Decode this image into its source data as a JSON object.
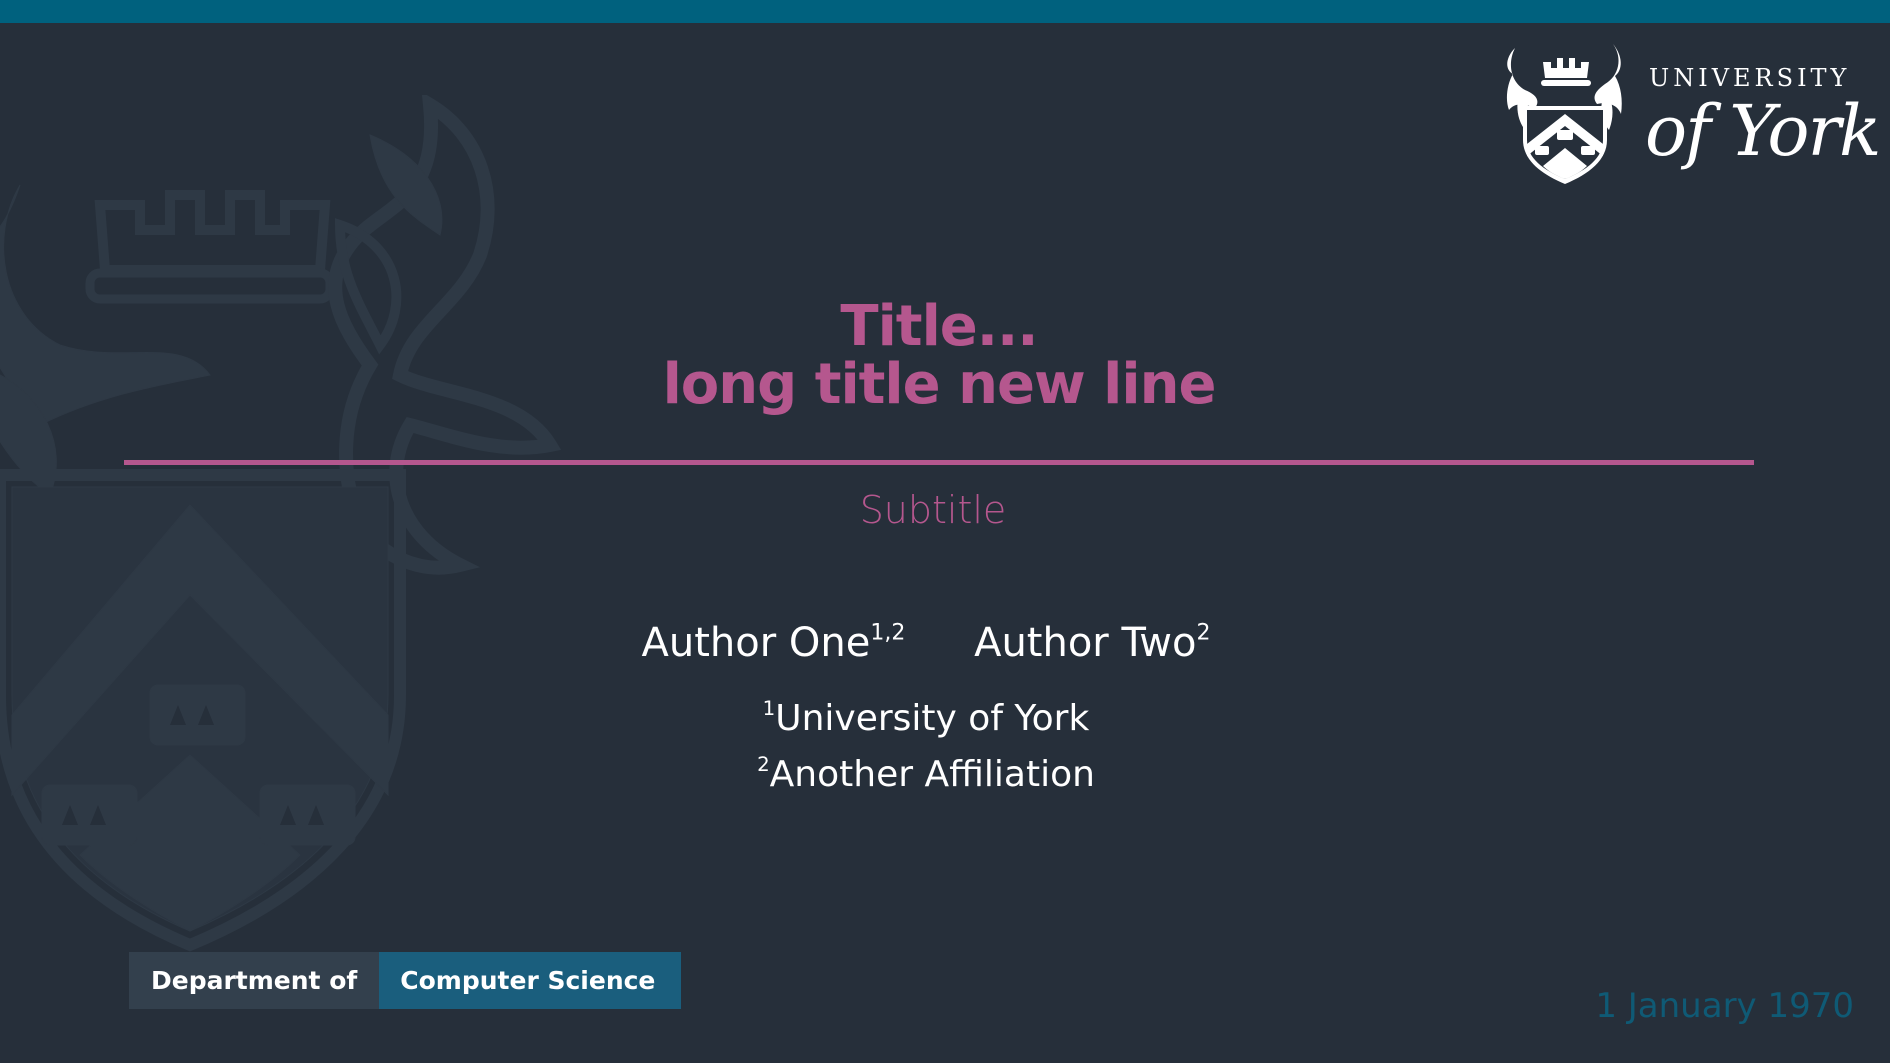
{
  "header": {
    "accent_color": "#00617e",
    "background_color": "#262f3a"
  },
  "logo": {
    "line1": "UNIVERSITY",
    "line2": "of York",
    "icon": "university-crest-icon"
  },
  "watermark": {
    "icon": "crest-watermark-icon"
  },
  "title": {
    "line1": "Title...",
    "line2": "long title new line",
    "color": "#b5578e"
  },
  "subtitle": "Subtitle",
  "authors": [
    {
      "name": "Author One",
      "affil_marks": "1,2"
    },
    {
      "name": "Author Two",
      "affil_marks": "2"
    }
  ],
  "affiliations": [
    {
      "mark": "1",
      "name": "University of York"
    },
    {
      "mark": "2",
      "name": "Another Affiliation"
    }
  ],
  "department": {
    "prefix": "Department of",
    "name": "Computer Science"
  },
  "date": "1 January 1970"
}
